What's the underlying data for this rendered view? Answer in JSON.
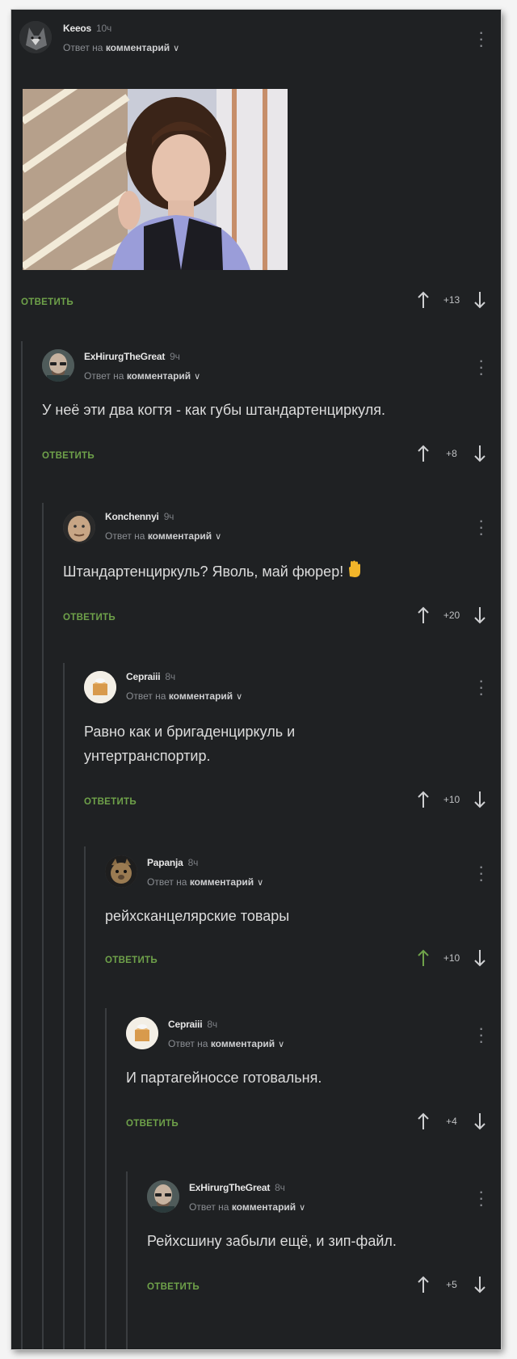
{
  "colors": {
    "background": "#1f2123",
    "text": "#dcdcdc",
    "muted": "#8b8e93",
    "accent_green": "#6fa24a",
    "thread_line": "#3a3d40"
  },
  "comments": [
    {
      "author": "Keeos",
      "time": "10ч",
      "reply_prefix": "Ответ на",
      "reply_target": "комментарий",
      "text": "",
      "has_image": true,
      "reply_label": "ОТВЕТИТЬ",
      "score": "+13",
      "upvoted": false,
      "avatar_icon": "wolf-avatar-icon"
    },
    {
      "author": "ExHirurgTheGreat",
      "time": "9ч",
      "reply_prefix": "Ответ на",
      "reply_target": "комментарий",
      "text": "У неё эти два когтя - как губы штандартенциркуля.",
      "reply_label": "ОТВЕТИТЬ",
      "score": "+8",
      "upvoted": false,
      "avatar_icon": "bald-man-avatar-icon"
    },
    {
      "author": "Konchennyi",
      "time": "9ч",
      "reply_prefix": "Ответ на",
      "reply_target": "комментарий",
      "text": "Штандартенциркуль? Яволь, май фюрер!",
      "emoji": "raised-hand-emoji",
      "reply_label": "ОТВЕТИТЬ",
      "score": "+20",
      "upvoted": false,
      "avatar_icon": "face-avatar-icon"
    },
    {
      "author": "Cepraiii",
      "time": "8ч",
      "reply_prefix": "Ответ на",
      "reply_target": "комментарий",
      "text_line1": "Равно как и бригаденциркуль и",
      "text_line2": "унтертранспортир.",
      "reply_label": "ОТВЕТИТЬ",
      "score": "+10",
      "upvoted": false,
      "avatar_icon": "box-avatar-icon"
    },
    {
      "author": "Papanja",
      "time": "8ч",
      "reply_prefix": "Ответ на",
      "reply_target": "комментарий",
      "text": "рейхсканцелярские товары",
      "reply_label": "ОТВЕТИТЬ",
      "score": "+10",
      "upvoted": true,
      "avatar_icon": "cat-avatar-icon"
    },
    {
      "author": "Cepraiii",
      "time": "8ч",
      "reply_prefix": "Ответ на",
      "reply_target": "комментарий",
      "text": "И партагейноссе готовальня.",
      "reply_label": "ОТВЕТИТЬ",
      "score": "+4",
      "upvoted": false,
      "avatar_icon": "box-avatar-icon"
    },
    {
      "author": "ExHirurgTheGreat",
      "time": "8ч",
      "reply_prefix": "Ответ на",
      "reply_target": "комментарий",
      "text": "Рейхсшину забыли ещё, и зип-файл.",
      "reply_label": "ОТВЕТИТЬ",
      "score": "+5",
      "upvoted": false,
      "avatar_icon": "bald-man-avatar-icon"
    }
  ]
}
